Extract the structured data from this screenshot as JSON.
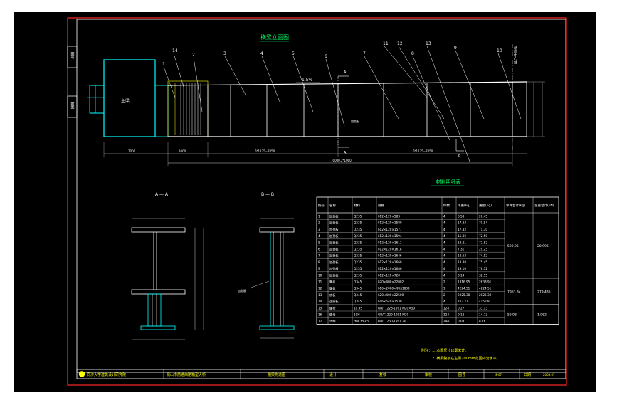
{
  "drawing": {
    "elevation_title": "横梁立面图",
    "section_a_title": "A — A",
    "section_b_title": "B — B",
    "table_title": "材料明细表",
    "main_girder_label": "主梁",
    "slope_label": "1.5%",
    "centerline_label": "桥面中心线",
    "section_mark": "A",
    "section_mark_b": "B",
    "stiffener_label": "加劲板",
    "callouts": [
      "1",
      "14",
      "2",
      "3",
      "4",
      "5",
      "6",
      "7",
      "11",
      "12",
      "8",
      "13",
      "9",
      "10"
    ],
    "dims_bottom": [
      "7000",
      "1000",
      "6*1175=7050",
      "6*1175=7050",
      "70000.2*1000"
    ],
    "left_vertical_tabs": [
      "图号",
      "附图"
    ],
    "notes_lines": [
      "附注：1. 本图尺寸以毫米计。",
      "2. 横梁腹板在主梁200mm范围内为水平。"
    ]
  },
  "table": {
    "headers": [
      "编号",
      "名称",
      "材料",
      "规格",
      "件数",
      "单重(kg)",
      "重量(kg)",
      "单件合计(kg)",
      "总重合计(kN)"
    ],
    "rows": [
      [
        "1",
        "加劲板",
        "Q235",
        "δ12×120×583",
        "4",
        "6.58",
        "26.45"
      ],
      [
        "2",
        "加劲板",
        "Q235",
        "δ12×120×1580",
        "4",
        "17.83",
        "70.54"
      ],
      [
        "3",
        "加劲板",
        "Q235",
        "δ12×120×1577",
        "4",
        "17.82",
        "71.30"
      ],
      [
        "4",
        "加劲板",
        "Q235",
        "δ12×120×1594",
        "4",
        "15.82",
        "72.50"
      ],
      [
        "5",
        "加劲板",
        "Q235",
        "δ12×120×1611",
        "4",
        "18.21",
        "72.82"
      ],
      [
        "6",
        "加劲板",
        "Q235",
        "δ12×120×1618",
        "4",
        "7.31",
        "29.25"
      ],
      [
        "7",
        "加劲板",
        "Q235",
        "δ12×120×1646",
        "4",
        "18.63",
        "74.52"
      ],
      [
        "8",
        "加劲板",
        "Q235",
        "δ12×120×1669",
        "4",
        "18.88",
        "75.45"
      ],
      [
        "9",
        "加劲板",
        "Q235",
        "δ12×120×1686",
        "4",
        "19.10",
        "76.32"
      ],
      [
        "10",
        "加劲板",
        "Q235",
        "δ12×120×720",
        "4",
        "8.14",
        "32.55"
      ],
      [
        "11",
        "翼板",
        "Q345",
        "δ20×400×22002",
        "2",
        "1316.95",
        "2633.91"
      ],
      [
        "12",
        "腹板",
        "Q345",
        "δ16×2000×平均1833",
        "1",
        "4224.51",
        "4224.51"
      ],
      [
        "13",
        "底板",
        "Q345",
        "δ20×400×22500",
        "2",
        "2025.30",
        "2025.30"
      ],
      [
        "14",
        "连接板",
        "Q345",
        "δ16×540×1530",
        "4",
        "103.77",
        "415.08"
      ],
      [
        "15",
        "螺栓",
        "10.9S",
        "GB/T1228-1991 M20×50",
        "124",
        "0.27",
        "33.13"
      ],
      [
        "16",
        "螺母",
        "10H",
        "GB/T1229-1991 M20",
        "124",
        "0.12",
        "14.73"
      ],
      [
        "17",
        "垫圈",
        "HRC35-45",
        "GB/T1230-1991 20",
        "248",
        "0.03",
        "8.16"
      ]
    ],
    "group_totals": [
      {
        "rows": "1-10",
        "unit_total": "599.95",
        "total": "20.996"
      },
      {
        "rows": "11-14",
        "unit_total": "7963.84",
        "total": "279.435"
      },
      {
        "rows": "15-17",
        "unit_total": "56.03",
        "total": "1.962"
      }
    ]
  },
  "title_block": {
    "institute": "同济大学建筑设计研究院",
    "project": "昆山市前进西路箱型大桥",
    "drawing_name": "横梁构造图",
    "design_label": "设计",
    "check_label": "复核",
    "review_label": "审核",
    "drawing_no_label": "图号",
    "drawing_no": "S-07",
    "date_label": "日期",
    "date": "2003.07"
  }
}
